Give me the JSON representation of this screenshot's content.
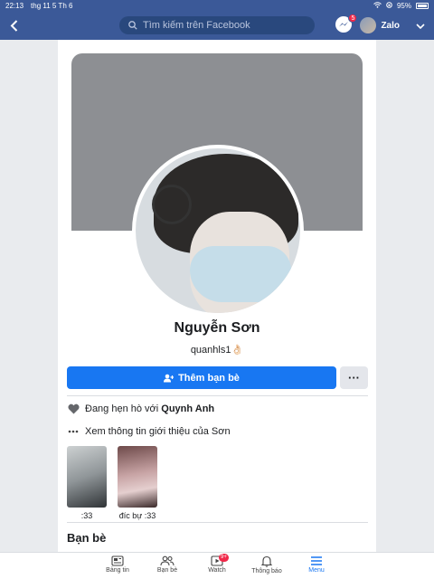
{
  "status_bar": {
    "time": "22:13",
    "date": "thg 11 5 Th 6",
    "battery": "95%"
  },
  "nav": {
    "search_placeholder": "Tìm kiếm trên Facebook",
    "messenger_badge": "5",
    "account_name": "Zalo"
  },
  "profile": {
    "name": "Nguyễn Sơn",
    "username": "quanhls1👌🏻",
    "add_friend_label": "Thêm bạn bè",
    "more_label": "···",
    "relationship_prefix": "Đang hẹn hò với ",
    "relationship_partner": "Quynh Anh",
    "about_link": "Xem thông tin giới thiệu của Sơn"
  },
  "featured_photos": [
    {
      "caption": ":33"
    },
    {
      "caption": "đíc bự :33"
    }
  ],
  "friends_section": {
    "title": "Bạn bè"
  },
  "tabbar": {
    "tabs": [
      {
        "label": "Bảng tin",
        "icon": "news-feed-icon"
      },
      {
        "label": "Bạn bè",
        "icon": "friends-icon"
      },
      {
        "label": "Watch",
        "icon": "watch-icon",
        "badge": "9+"
      },
      {
        "label": "Thông báo",
        "icon": "bell-icon"
      },
      {
        "label": "Menu",
        "icon": "menu-icon"
      }
    ]
  },
  "colors": {
    "brand": "#3b5998",
    "accent": "#1877f2",
    "badge": "#f02849"
  }
}
